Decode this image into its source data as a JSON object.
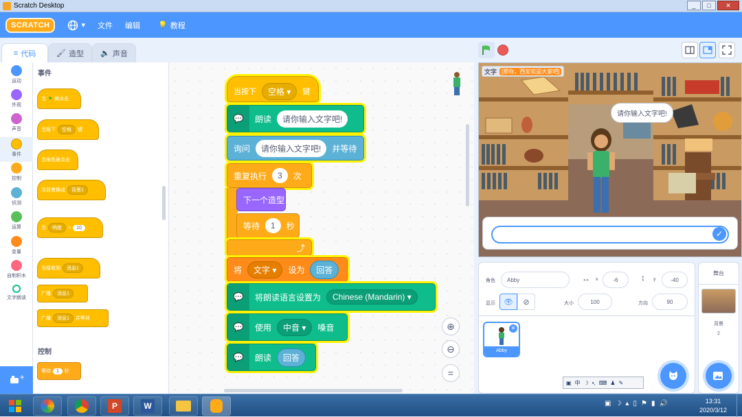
{
  "window": {
    "title": "Scratch Desktop"
  },
  "menubar": {
    "logo": "SCRATCH",
    "file": "文件",
    "edit": "编辑",
    "tutorials": "教程"
  },
  "tabs": [
    {
      "label": "代码"
    },
    {
      "label": "造型"
    },
    {
      "label": "声音"
    }
  ],
  "categories": [
    {
      "label": "运动",
      "color": "#4c97ff"
    },
    {
      "label": "外观",
      "color": "#9966ff"
    },
    {
      "label": "声音",
      "color": "#cf63cf"
    },
    {
      "label": "事件",
      "color": "#ffbf00"
    },
    {
      "label": "控制",
      "color": "#ffab19"
    },
    {
      "label": "侦测",
      "color": "#5cb1d6"
    },
    {
      "label": "运算",
      "color": "#59c059"
    },
    {
      "label": "变量",
      "color": "#ff8c1a"
    },
    {
      "label": "自制积木",
      "color": "#ff6680"
    },
    {
      "label": "文字朗读",
      "color": "#0fbd8c"
    }
  ],
  "palette": {
    "events_header": "事件",
    "control_header": "控制",
    "blocks": {
      "flag_clicked_pre": "当",
      "flag_clicked_post": "被点击",
      "key_pressed_pre": "当按下",
      "key_pressed_key": "空格",
      "key_pressed_post": "键",
      "sprite_clicked": "当角色被点击",
      "backdrop_switch": "当背景换成",
      "backdrop_name": "背景1",
      "when_gt_pre": "当",
      "when_gt_menu": "响度",
      "when_gt_op": ">",
      "when_gt_val": "10",
      "receive_pre": "当接收到",
      "receive_msg": "消息1",
      "broadcast": "广播",
      "broadcast_msg": "消息1",
      "broadcast_wait": "广播",
      "broadcast_wait_msg": "消息1",
      "broadcast_wait_post": "并等待",
      "wait_pre": "等待",
      "wait_val": "1",
      "wait_post": "秒"
    }
  },
  "script": {
    "hat_pre": "当按下",
    "hat_key": "空格",
    "hat_post": "键",
    "speak1_label": "朗读",
    "speak1_text": "请你输入文字吧!",
    "ask_label": "询问",
    "ask_text": "请你输入文字吧!",
    "ask_post": "并等待",
    "repeat_label": "重复执行",
    "repeat_count": "3",
    "repeat_post": "次",
    "next_costume": "下一个造型",
    "wait_label": "等待",
    "wait_val": "1",
    "wait_post": "秒",
    "set_label": "将",
    "set_var": "文字",
    "set_mid": "设为",
    "set_val": "回答",
    "lang_label": "将朗读语言设置为",
    "lang_val": "Chinese (Mandarin)",
    "voice_pre": "使用",
    "voice_val": "中音",
    "voice_post": "嗓音",
    "speak2_label": "朗读",
    "speak2_val": "回答"
  },
  "stage": {
    "var_name": "文字",
    "var_value": "[那你，西安欢迎大家吧]",
    "speech": "请你输入文字吧!"
  },
  "sprite_info": {
    "sprite_label": "角色",
    "sprite_name": "Abby",
    "x_label": "x",
    "x": "-6",
    "y_label": "y",
    "y": "-40",
    "show_label": "显示",
    "size_label": "大小",
    "size": "100",
    "direction_label": "方向",
    "direction": "90",
    "thumb_name": "Abby"
  },
  "stage_panel": {
    "title": "舞台",
    "backdrop_label": "背景",
    "backdrop_count": "2"
  },
  "taskbar": {
    "time": "13:31",
    "date": "2020/3/12",
    "ime": "中"
  }
}
